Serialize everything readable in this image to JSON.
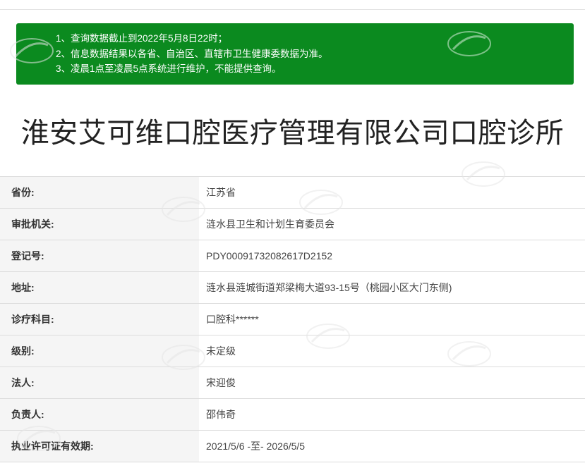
{
  "notice": {
    "lines": [
      "1、查询数据截止到2022年5月8日22时；",
      "2、信息数据结果以各省、自治区、直辖市卫生健康委数据为准。",
      "3、凌晨1点至凌晨5点系统进行维护，不能提供查询。"
    ]
  },
  "clinic_name": "淮安艾可维口腔医疗管理有限公司口腔诊所",
  "rows": [
    {
      "label": "省份:",
      "value": "江苏省"
    },
    {
      "label": "审批机关:",
      "value": "涟水县卫生和计划生育委员会"
    },
    {
      "label": "登记号:",
      "value": "PDY00091732082617D2152"
    },
    {
      "label": "地址:",
      "value": "涟水县涟城街道郑梁梅大道93-15号（桃园小区大门东侧)"
    },
    {
      "label": "诊疗科目:",
      "value": "口腔科******"
    },
    {
      "label": "级别:",
      "value": "未定级"
    },
    {
      "label": "法人:",
      "value": "宋迎俊"
    },
    {
      "label": "负责人:",
      "value": "邵伟奇"
    },
    {
      "label": "执业许可证有效期:",
      "value": "2021/5/6 -至- 2026/5/5"
    }
  ],
  "colors": {
    "notice_bg": "#0b8a1f",
    "label_bg": "#f5f5f5",
    "border": "#dcdcdc"
  },
  "watermark": "logo-watermark"
}
